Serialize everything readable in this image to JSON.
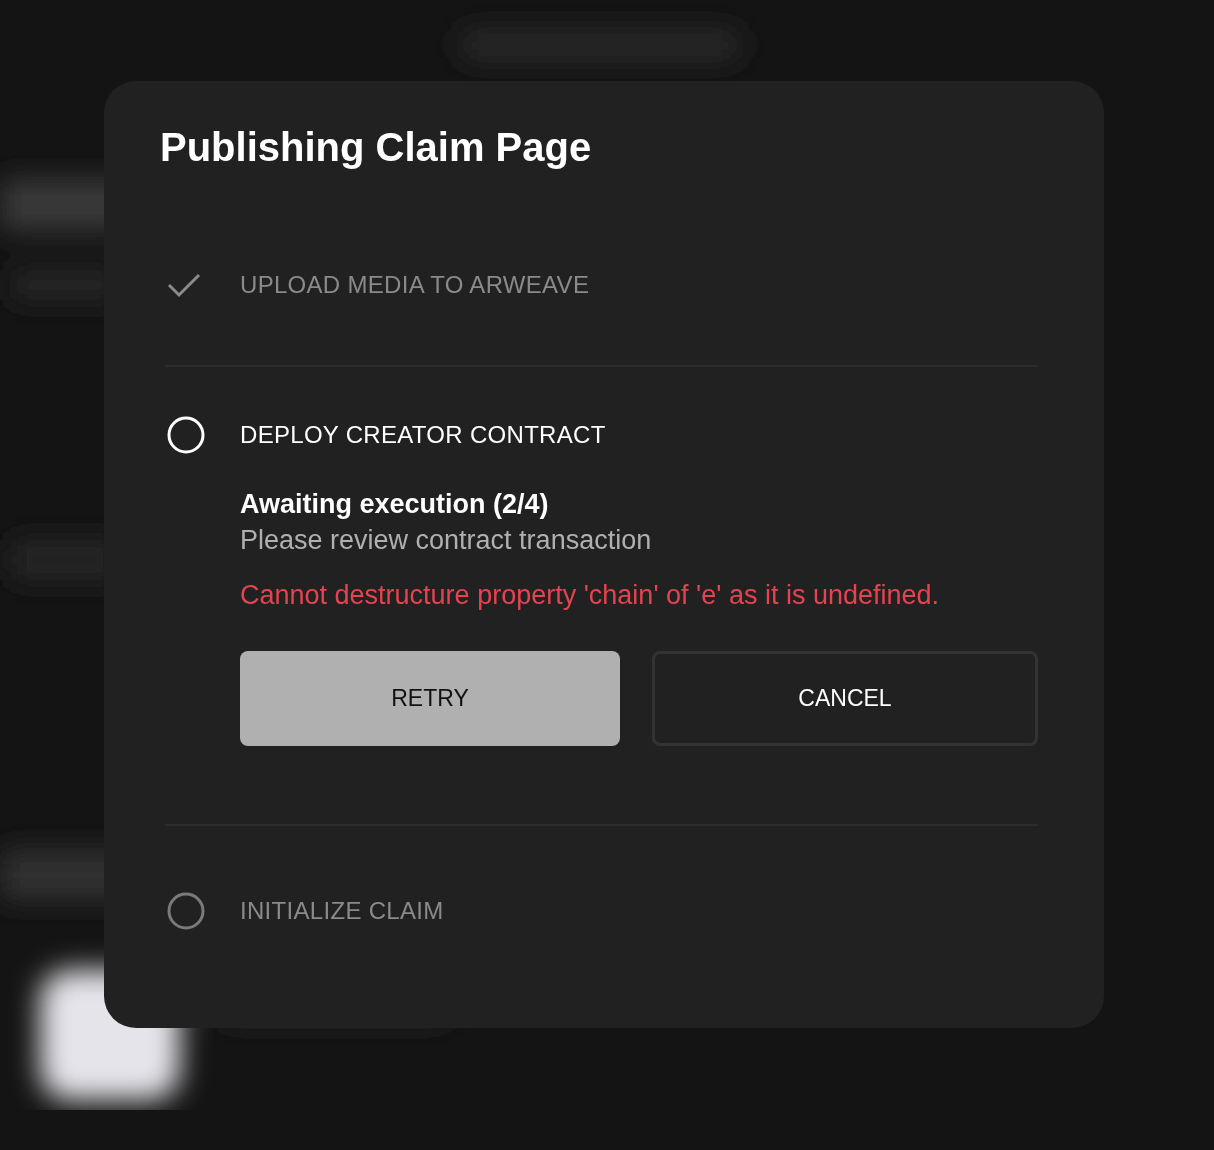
{
  "dialog": {
    "title": "Publishing Claim Page",
    "steps": [
      {
        "label": "UPLOAD MEDIA TO ARWEAVE",
        "done": true,
        "active": false
      },
      {
        "label": "DEPLOY CREATOR CONTRACT",
        "done": false,
        "active": true,
        "status_title": "Awaiting execution (2/4)",
        "status_text": "Please review contract transaction",
        "error": "Cannot destructure property 'chain' of 'e' as it is undefined.",
        "buttons": [
          {
            "label": "RETRY",
            "kind": "primary"
          },
          {
            "label": "CANCEL",
            "kind": "secondary"
          }
        ]
      },
      {
        "label": "INITIALIZE CLAIM",
        "done": false,
        "active": false
      }
    ]
  }
}
